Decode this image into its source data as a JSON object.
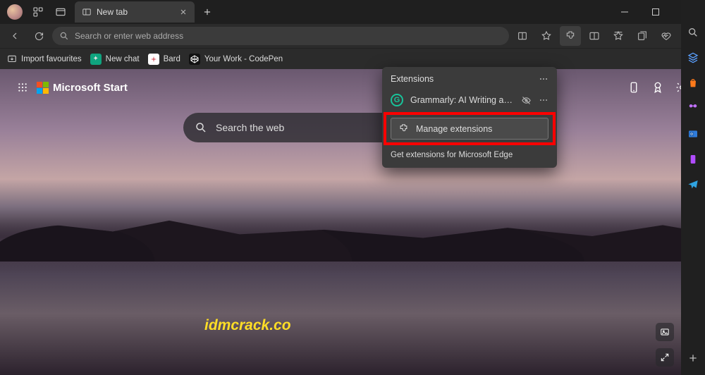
{
  "titlebar": {
    "tab_title": "New tab"
  },
  "toolbar": {
    "address_placeholder": "Search or enter web address"
  },
  "favbar": {
    "import": "Import favourites",
    "newchat": "New chat",
    "bard": "Bard",
    "codepen": "Your Work - CodePen"
  },
  "start": {
    "brand": "Microsoft Start",
    "search_placeholder": "Search the web"
  },
  "extensions": {
    "title": "Extensions",
    "item1": "Grammarly: AI Writing and Gramm…",
    "manage": "Manage extensions",
    "get": "Get extensions for Microsoft Edge"
  },
  "watermark": "idmcrack.co"
}
